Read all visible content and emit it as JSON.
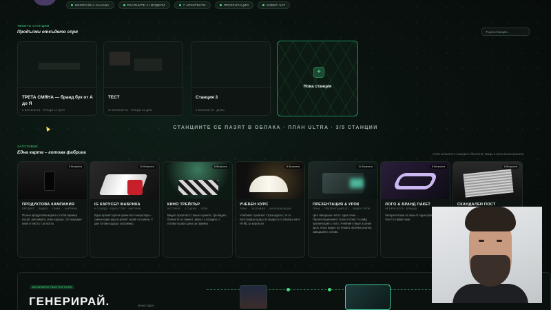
{
  "top_nav": {
    "pills": [
      "БЕЗКРАЙНА КАНАВА",
      "РЕАЛНИТЕ AI МОДЕЛИ",
      "7 АРХИТЕКТИ",
      "ПРЕЗЕНТАЦИИ",
      "ХИБЕР ЧАТ"
    ]
  },
  "stations": {
    "kicker": "ТВОИТЕ СТАНЦИИ",
    "title": "Продължи откъдето спря",
    "search_placeholder": "Търси станция...",
    "cards": [
      {
        "title": "ТРЕТА СМЯНА — бранд бук от А до Я",
        "meta": "6 БЛОКЧЕТА · ПРЕДИ 17 ДНИ"
      },
      {
        "title": "ТЕСТ",
        "meta": "27 БЛОКЧЕТА · ПРЕДИ 26 ДНИ"
      },
      {
        "title": "Станция 3",
        "meta": "0 БЛОКЧЕТА · ДНЕС"
      }
    ],
    "new_station_label": "Нова станция",
    "new_station_icon": "plus-icon"
  },
  "cloud_note": "СТАНЦИИТЕ СЕ ПАЗЯТ В ОБЛАКА · ПЛАН ULTRA · 3/5 СТАНЦИИ",
  "templates": {
    "kicker": "ЗАГОТОВКИ",
    "title": "Една карта – готова фабрика",
    "hint": "готов началното станции с блокчета, маще и попълнени проекти",
    "cards": [
      {
        "badge": "8 блокчета",
        "title": "ПРОДУКТОВА КАМПАНИЯ",
        "meta": "ПРОДУКТ → ВИДЕО → СНИМ → КАРТИНИ",
        "desc": "Пълна продуктова верига с готов пример вътре: рекламата, кино кадъра, 10-секунден клип и текстът за поста."
      },
      {
        "badge": "10 блокчета",
        "title": "IG КАРУСЕЛ ФАБРИКА",
        "meta": "6 СЛАЙДА · ЕДНО СТИЛ · КАРТИНИ",
        "desc": "Една промпт купчи храни пет генератора – смени един ред и целият серия се смени. С две готови кадъра за пример."
      },
      {
        "badge": "8 блокчета",
        "title": "КИНО ТРЕЙЛЪР",
        "meta": "ИСТОРИЯ → 4 СЦЕНИ → ЗОРА",
        "desc": "Видео Архитектът пише сцените, три видео блокчета ги снимат, звукът е вграден. С готова първа сцена за пример."
      },
      {
        "badge": "8 блокчета",
        "title": "УЧЕБЕН КУРС",
        "meta": "ТЕМА → ЗАГЛАВИЯ → ВИЗУАЛИЗАЦИИ",
        "desc": "Учебният Архитект строи курсът, те го конструира кадър по модул и го свалиш като HTML за курсисти."
      },
      {
        "badge": "11 блокчета",
        "title": "ПРЕЗЕНТАЦИЯ & УРОК",
        "meta": "ТЕМА → ПРЕЗЕНТАЦИЯ (7) → ВИДЕО УРОК",
        "desc": "Цял завършен потос: една тема → Презентационният строи готова 7-слайд презентация с лого, Учебният пише пълния урок, плюс видео по темата. Всичко реално, завършено, готово."
      },
      {
        "badge": "8 блокчета",
        "title": "ЛОГО & БРАНД ПАКЕТ",
        "meta": "ЧЕТИРИ ЛОГА · БРАНДА",
        "desc": "Четири посоки за знак от един промпт – без текст в самия знак."
      },
      {
        "badge": "8 блокчета",
        "title": "СКАНДАЛЕН ПОСТ",
        "meta": "",
        "desc": "Целия концепт за пример в бранд, Бележка с правилата на употреба."
      }
    ]
  },
  "bottom": {
    "tag": "БЕЗКРАЙНО РАБОТНО ПОЛЕ",
    "headline": "ГЕНЕРИРАЙ.",
    "box_label": "МОЖЕ ИДЕЯ"
  },
  "colors": {
    "accent": "#4ade80",
    "background": "#0a120f"
  }
}
